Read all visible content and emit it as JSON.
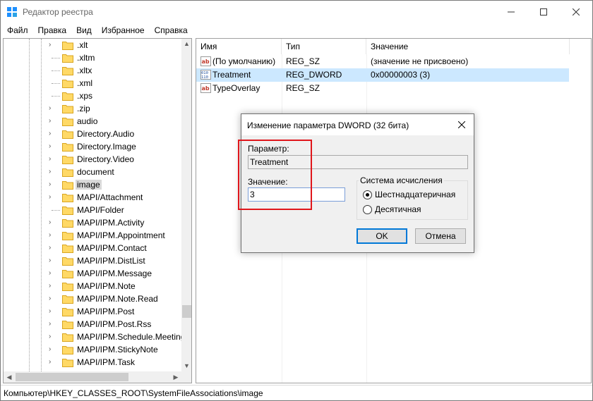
{
  "window": {
    "title": "Редактор реестра"
  },
  "menu": [
    "Файл",
    "Правка",
    "Вид",
    "Избранное",
    "Справка"
  ],
  "tree": {
    "selected_index": 11,
    "items": [
      {
        "label": ".xlt",
        "expandable": true
      },
      {
        "label": ".xltm",
        "expandable": false
      },
      {
        "label": ".xltx",
        "expandable": false
      },
      {
        "label": ".xml",
        "expandable": false
      },
      {
        "label": ".xps",
        "expandable": false
      },
      {
        "label": ".zip",
        "expandable": true
      },
      {
        "label": "audio",
        "expandable": true
      },
      {
        "label": "Directory.Audio",
        "expandable": true
      },
      {
        "label": "Directory.Image",
        "expandable": true
      },
      {
        "label": "Directory.Video",
        "expandable": true
      },
      {
        "label": "document",
        "expandable": true
      },
      {
        "label": "image",
        "expandable": true
      },
      {
        "label": "MAPI/Attachment",
        "expandable": true
      },
      {
        "label": "MAPI/Folder",
        "expandable": false
      },
      {
        "label": "MAPI/IPM.Activity",
        "expandable": true
      },
      {
        "label": "MAPI/IPM.Appointment",
        "expandable": true
      },
      {
        "label": "MAPI/IPM.Contact",
        "expandable": true
      },
      {
        "label": "MAPI/IPM.DistList",
        "expandable": true
      },
      {
        "label": "MAPI/IPM.Message",
        "expandable": true
      },
      {
        "label": "MAPI/IPM.Note",
        "expandable": true
      },
      {
        "label": "MAPI/IPM.Note.Read",
        "expandable": true
      },
      {
        "label": "MAPI/IPM.Post",
        "expandable": true
      },
      {
        "label": "MAPI/IPM.Post.Rss",
        "expandable": true
      },
      {
        "label": "MAPI/IPM.Schedule.Meeting",
        "expandable": true
      },
      {
        "label": "MAPI/IPM.StickyNote",
        "expandable": true
      },
      {
        "label": "MAPI/IPM.Task",
        "expandable": true
      }
    ]
  },
  "list": {
    "columns": [
      "Имя",
      "Тип",
      "Значение"
    ],
    "selected_index": 1,
    "rows": [
      {
        "name": "(По умолчанию)",
        "type": "REG_SZ",
        "value": "(значение не присвоено)",
        "icon": "string-value-icon"
      },
      {
        "name": "Treatment",
        "type": "REG_DWORD",
        "value": "0x00000003 (3)",
        "icon": "binary-value-icon"
      },
      {
        "name": "TypeOverlay",
        "type": "REG_SZ",
        "value": "",
        "icon": "string-value-icon"
      }
    ]
  },
  "status": {
    "path": "Компьютер\\HKEY_CLASSES_ROOT\\SystemFileAssociations\\image"
  },
  "dialog": {
    "title": "Изменение параметра DWORD (32 бита)",
    "name_label": "Параметр:",
    "name_value": "Treatment",
    "value_label": "Значение:",
    "value_value": "3",
    "base_group_label": "Система исчисления",
    "radio_hex": "Шестнадцатеричная",
    "radio_dec": "Десятичная",
    "selected_base": "hex",
    "ok_label": "OK",
    "cancel_label": "Отмена"
  },
  "colors": {
    "selection": "#cce8ff",
    "tree_selection": "#d9d9d9",
    "highlight": "#e0161b",
    "folder": "#ffd966",
    "accent": "#0078d7"
  }
}
